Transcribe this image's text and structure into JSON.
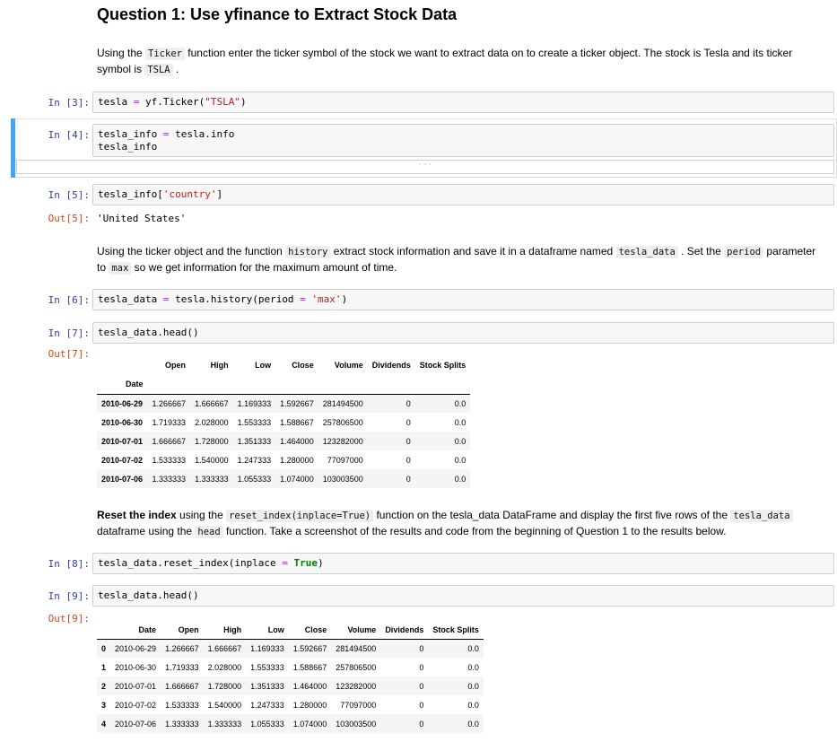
{
  "heading": "Question 1: Use yfinance to Extract Stock Data",
  "md1": {
    "t1": "Using the ",
    "c1": "Ticker",
    "t2": " function enter the ticker symbol of the stock we want to extract data on to create a ticker object. The stock is Tesla and its ticker symbol is ",
    "c2": "TSLA",
    "t3": " ."
  },
  "cells": {
    "c3": {
      "prompt": "In [3]:",
      "a": "tesla ",
      "op": "=",
      "b": " yf.Ticker(",
      "s": "\"TSLA\"",
      "c": ")"
    },
    "c4": {
      "prompt": "In [4]:",
      "l1a": "tesla_info ",
      "op": "=",
      "l1b": " tesla.info",
      "l2": "tesla_info",
      "collapsed": "· · ·"
    },
    "c5": {
      "prompt": "In [5]:",
      "a": "tesla_info[",
      "s": "'country'",
      "b": "]",
      "out_prompt": "Out[5]:",
      "out": "'United States'"
    },
    "c6": {
      "prompt": "In [6]:",
      "a": "tesla_data ",
      "op": "=",
      "b": " tesla.history(period ",
      "op2": "=",
      "s": " 'max'",
      "c": ")"
    },
    "c7": {
      "prompt": "In [7]:",
      "code": "tesla_data.head()",
      "out_prompt": "Out[7]:"
    },
    "c8": {
      "prompt": "In [8]:",
      "a": "tesla_data.reset_index(inplace ",
      "op": "=",
      "kw": " True",
      "b": ")"
    },
    "c9": {
      "prompt": "In [9]:",
      "code": "tesla_data.head()",
      "out_prompt": "Out[9]:"
    }
  },
  "md2": {
    "t1": "Using the ticker object and the function ",
    "c1": "history",
    "t2": " extract stock information and save it in a dataframe named ",
    "c2": "tesla_data",
    "t3": " . Set the ",
    "c3": "period",
    "t4": " parameter to ",
    "c4": "max",
    "t5": " so we get information for the maximum amount of time."
  },
  "md3": {
    "b1": "Reset the index",
    "t1": " using the ",
    "c1": "reset_index(inplace=True)",
    "t2": " function on the tesla_data DataFrame and display the first five rows of the ",
    "c2": "tesla_data",
    "t3": " dataframe using the ",
    "c3": "head",
    "t4": " function. Take a screenshot of the results and code from the beginning of Question 1 to the results below."
  },
  "df1": {
    "columns": [
      "Open",
      "High",
      "Low",
      "Close",
      "Volume",
      "Dividends",
      "Stock Splits"
    ],
    "index_name": "Date",
    "rows": [
      [
        "2010-06-29",
        "1.266667",
        "1.666667",
        "1.169333",
        "1.592667",
        "281494500",
        "0",
        "0.0"
      ],
      [
        "2010-06-30",
        "1.719333",
        "2.028000",
        "1.553333",
        "1.588667",
        "257806500",
        "0",
        "0.0"
      ],
      [
        "2010-07-01",
        "1.666667",
        "1.728000",
        "1.351333",
        "1.464000",
        "123282000",
        "0",
        "0.0"
      ],
      [
        "2010-07-02",
        "1.533333",
        "1.540000",
        "1.247333",
        "1.280000",
        "77097000",
        "0",
        "0.0"
      ],
      [
        "2010-07-06",
        "1.333333",
        "1.333333",
        "1.055333",
        "1.074000",
        "103003500",
        "0",
        "0.0"
      ]
    ]
  },
  "df2": {
    "columns": [
      "",
      "Date",
      "Open",
      "High",
      "Low",
      "Close",
      "Volume",
      "Dividends",
      "Stock Splits"
    ],
    "rows": [
      [
        "0",
        "2010-06-29",
        "1.266667",
        "1.666667",
        "1.169333",
        "1.592667",
        "281494500",
        "0",
        "0.0"
      ],
      [
        "1",
        "2010-06-30",
        "1.719333",
        "2.028000",
        "1.553333",
        "1.588667",
        "257806500",
        "0",
        "0.0"
      ],
      [
        "2",
        "2010-07-01",
        "1.666667",
        "1.728000",
        "1.351333",
        "1.464000",
        "123282000",
        "0",
        "0.0"
      ],
      [
        "3",
        "2010-07-02",
        "1.533333",
        "1.540000",
        "1.247333",
        "1.280000",
        "77097000",
        "0",
        "0.0"
      ],
      [
        "4",
        "2010-07-06",
        "1.333333",
        "1.333333",
        "1.055333",
        "1.074000",
        "103003500",
        "0",
        "0.0"
      ]
    ]
  }
}
